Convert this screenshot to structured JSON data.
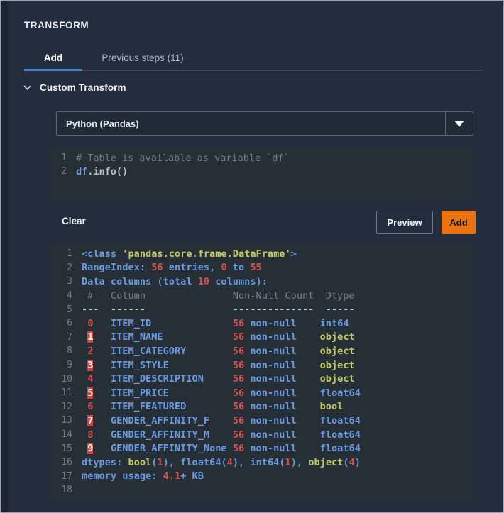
{
  "panel": {
    "title": "TRANSFORM"
  },
  "tabs": [
    {
      "label": "Add",
      "active": true
    },
    {
      "label": "Previous steps (11)",
      "active": false
    }
  ],
  "section": {
    "label": "Custom Transform",
    "chevron_icon": "chevron-down-icon",
    "expanded": true
  },
  "language_select": {
    "value": "Python (Pandas)",
    "arrow_icon": "caret-down-icon",
    "options": [
      "Python (Pandas)"
    ]
  },
  "code_editor": {
    "lines": [
      {
        "n": "1",
        "segments": [
          {
            "t": "# Table is available as variable `df`",
            "c": "cm"
          }
        ]
      },
      {
        "n": "2",
        "segments": [
          {
            "t": "df",
            "c": "cv"
          },
          {
            "t": ".info()",
            "c": "cp"
          }
        ]
      }
    ]
  },
  "actions": {
    "clear_label": "Clear",
    "preview_label": "Preview",
    "add_label": "Add",
    "add_color": "#ec7211"
  },
  "console": {
    "lines": [
      {
        "n": "1",
        "segments": [
          {
            "t": "<class ",
            "c": "s-blue"
          },
          {
            "t": "'pandas.core.frame.DataFrame'",
            "c": "s-olive"
          },
          {
            "t": ">",
            "c": "s-blue"
          }
        ]
      },
      {
        "n": "2",
        "segments": [
          {
            "t": "RangeIndex: ",
            "c": "s-blue"
          },
          {
            "t": "56",
            "c": "s-red"
          },
          {
            "t": " entries, ",
            "c": "s-blue"
          },
          {
            "t": "0",
            "c": "s-red"
          },
          {
            "t": " to ",
            "c": "s-blue"
          },
          {
            "t": "55",
            "c": "s-red"
          }
        ]
      },
      {
        "n": "3",
        "segments": [
          {
            "t": "Data columns (total ",
            "c": "s-blue"
          },
          {
            "t": "10",
            "c": "s-red"
          },
          {
            "t": " columns):",
            "c": "s-blue"
          }
        ]
      },
      {
        "n": "4",
        "segments": [
          {
            "t": " #   Column               Non-Null Count  Dtype",
            "c": "s-gray"
          }
        ]
      },
      {
        "n": "5",
        "segments": [
          {
            "t": "---  ------               --------------  -----",
            "c": "s-white"
          }
        ]
      },
      {
        "n": "6",
        "segments": [
          {
            "t": " ",
            "c": "s-blue"
          },
          {
            "t": "0",
            "c": "s-red"
          },
          {
            "t": "   ",
            "c": "s-blue"
          },
          {
            "t": "ITEM_ID              ",
            "c": "s-blue"
          },
          {
            "t": "56",
            "c": "s-red"
          },
          {
            "t": " non-null    ",
            "c": "s-blue"
          },
          {
            "t": "int64",
            "c": "s-blue"
          }
        ]
      },
      {
        "n": "7",
        "segments": [
          {
            "t": " ",
            "c": "s-blue"
          },
          {
            "t": "1",
            "c": "s-hl"
          },
          {
            "t": "   ",
            "c": "s-blue"
          },
          {
            "t": "ITEM_NAME            ",
            "c": "s-blue"
          },
          {
            "t": "56",
            "c": "s-red"
          },
          {
            "t": " non-null    ",
            "c": "s-blue"
          },
          {
            "t": "object",
            "c": "s-olive"
          }
        ]
      },
      {
        "n": "8",
        "segments": [
          {
            "t": " ",
            "c": "s-blue"
          },
          {
            "t": "2",
            "c": "s-red"
          },
          {
            "t": "   ",
            "c": "s-blue"
          },
          {
            "t": "ITEM_CATEGORY        ",
            "c": "s-blue"
          },
          {
            "t": "56",
            "c": "s-red"
          },
          {
            "t": " non-null    ",
            "c": "s-blue"
          },
          {
            "t": "object",
            "c": "s-olive"
          }
        ]
      },
      {
        "n": "9",
        "segments": [
          {
            "t": " ",
            "c": "s-blue"
          },
          {
            "t": "3",
            "c": "s-hl"
          },
          {
            "t": "   ",
            "c": "s-blue"
          },
          {
            "t": "ITEM_STYLE           ",
            "c": "s-blue"
          },
          {
            "t": "56",
            "c": "s-red"
          },
          {
            "t": " non-null    ",
            "c": "s-blue"
          },
          {
            "t": "object",
            "c": "s-olive"
          }
        ]
      },
      {
        "n": "10",
        "segments": [
          {
            "t": " ",
            "c": "s-blue"
          },
          {
            "t": "4",
            "c": "s-red"
          },
          {
            "t": "   ",
            "c": "s-blue"
          },
          {
            "t": "ITEM_DESCRIPTION     ",
            "c": "s-blue"
          },
          {
            "t": "56",
            "c": "s-red"
          },
          {
            "t": " non-null    ",
            "c": "s-blue"
          },
          {
            "t": "object",
            "c": "s-olive"
          }
        ]
      },
      {
        "n": "11",
        "segments": [
          {
            "t": " ",
            "c": "s-blue"
          },
          {
            "t": "5",
            "c": "s-hl"
          },
          {
            "t": "   ",
            "c": "s-blue"
          },
          {
            "t": "ITEM_PRICE           ",
            "c": "s-blue"
          },
          {
            "t": "56",
            "c": "s-red"
          },
          {
            "t": " non-null    ",
            "c": "s-blue"
          },
          {
            "t": "float64",
            "c": "s-blue"
          }
        ]
      },
      {
        "n": "12",
        "segments": [
          {
            "t": " ",
            "c": "s-blue"
          },
          {
            "t": "6",
            "c": "s-red"
          },
          {
            "t": "   ",
            "c": "s-blue"
          },
          {
            "t": "ITEM_FEATURED        ",
            "c": "s-blue"
          },
          {
            "t": "56",
            "c": "s-red"
          },
          {
            "t": " non-null    ",
            "c": "s-blue"
          },
          {
            "t": "bool",
            "c": "s-olive"
          }
        ]
      },
      {
        "n": "13",
        "segments": [
          {
            "t": " ",
            "c": "s-blue"
          },
          {
            "t": "7",
            "c": "s-hl"
          },
          {
            "t": "   ",
            "c": "s-blue"
          },
          {
            "t": "GENDER_AFFINITY_F    ",
            "c": "s-blue"
          },
          {
            "t": "56",
            "c": "s-red"
          },
          {
            "t": " non-null    ",
            "c": "s-blue"
          },
          {
            "t": "float64",
            "c": "s-blue"
          }
        ]
      },
      {
        "n": "14",
        "segments": [
          {
            "t": " ",
            "c": "s-blue"
          },
          {
            "t": "8",
            "c": "s-red"
          },
          {
            "t": "   ",
            "c": "s-blue"
          },
          {
            "t": "GENDER_AFFINITY_M    ",
            "c": "s-blue"
          },
          {
            "t": "56",
            "c": "s-red"
          },
          {
            "t": " non-null    ",
            "c": "s-blue"
          },
          {
            "t": "float64",
            "c": "s-blue"
          }
        ]
      },
      {
        "n": "15",
        "segments": [
          {
            "t": " ",
            "c": "s-blue"
          },
          {
            "t": "9",
            "c": "s-hl"
          },
          {
            "t": "   ",
            "c": "s-blue"
          },
          {
            "t": "GENDER_AFFINITY_None ",
            "c": "s-blue"
          },
          {
            "t": "56",
            "c": "s-red"
          },
          {
            "t": " non-null    ",
            "c": "s-blue"
          },
          {
            "t": "float64",
            "c": "s-blue"
          }
        ]
      },
      {
        "n": "16",
        "segments": [
          {
            "t": "dtypes: ",
            "c": "s-blue"
          },
          {
            "t": "bool",
            "c": "s-olive"
          },
          {
            "t": "(",
            "c": "s-blue"
          },
          {
            "t": "1",
            "c": "s-red"
          },
          {
            "t": "), ",
            "c": "s-blue"
          },
          {
            "t": "float64",
            "c": "s-blue"
          },
          {
            "t": "(",
            "c": "s-blue"
          },
          {
            "t": "4",
            "c": "s-red"
          },
          {
            "t": "), ",
            "c": "s-blue"
          },
          {
            "t": "int64",
            "c": "s-blue"
          },
          {
            "t": "(",
            "c": "s-blue"
          },
          {
            "t": "1",
            "c": "s-red"
          },
          {
            "t": "), ",
            "c": "s-blue"
          },
          {
            "t": "object",
            "c": "s-olive"
          },
          {
            "t": "(",
            "c": "s-blue"
          },
          {
            "t": "4",
            "c": "s-red"
          },
          {
            "t": ")",
            "c": "s-blue"
          }
        ]
      },
      {
        "n": "17",
        "segments": [
          {
            "t": "memory usage: ",
            "c": "s-blue"
          },
          {
            "t": "4.1",
            "c": "s-red"
          },
          {
            "t": "+ KB",
            "c": "s-blue"
          }
        ]
      },
      {
        "n": "18",
        "segments": [
          {
            "t": "",
            "c": "s-blue"
          }
        ]
      }
    ]
  }
}
